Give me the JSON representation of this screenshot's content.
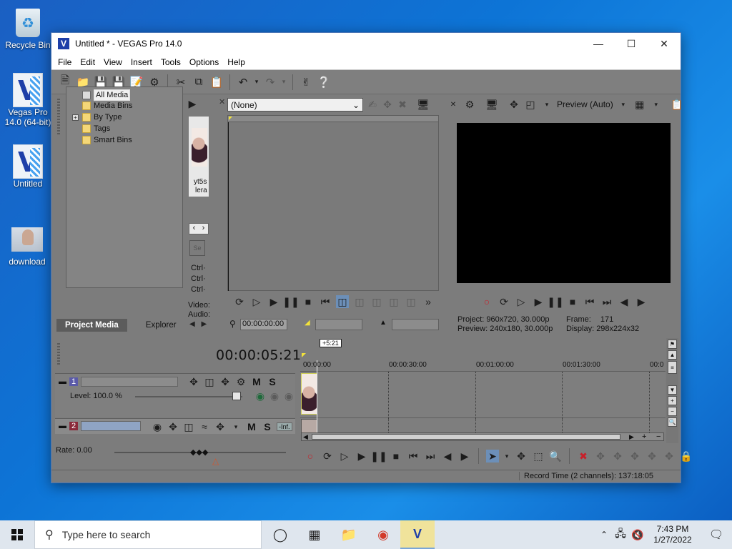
{
  "desktop": {
    "icons": [
      {
        "label": "Recycle Bin"
      },
      {
        "label": "Vegas Pro\n14.0 (64-bit)"
      },
      {
        "label": "Untitled"
      },
      {
        "label": "download"
      }
    ]
  },
  "window": {
    "title": "Untitled * - VEGAS Pro 14.0",
    "menu": [
      "File",
      "Edit",
      "View",
      "Insert",
      "Tools",
      "Options",
      "Help"
    ]
  },
  "project_media": {
    "tree": [
      "All Media",
      "Media Bins",
      "By Type",
      "Tags",
      "Smart Bins"
    ],
    "thumb_caption_1": "yt5s",
    "thumb_caption_2": "lera",
    "ctrl_lines": [
      "Ctrl·",
      "Ctrl·",
      "Ctrl·"
    ],
    "video_label": "Video:",
    "audio_label": "Audio:",
    "tab_active": "Project Media",
    "tab_other": "Explorer"
  },
  "trimmer": {
    "dropdown": "(None)",
    "timecode": "00:00:00:00"
  },
  "preview": {
    "mode": "Preview (Auto)",
    "project_label": "Project:",
    "project_value": "960x720, 30.000p",
    "preview_label": "Preview:",
    "preview_value": "240x180, 30.000p",
    "frame_label": "Frame:",
    "frame_value": "171",
    "display_label": "Display:",
    "display_value": "298x224x32"
  },
  "timeline": {
    "cursor_time": "00:00:05:21",
    "marker": "+5:21",
    "ruler": [
      "00:00:00",
      "00:00:30:00",
      "00:01:00:00",
      "00:01:30:00",
      "00:0"
    ],
    "track1_num": "1",
    "track1_letters": [
      "M",
      "S"
    ],
    "level": "Level: 100.0 %",
    "track2_num": "2",
    "track2_letters": [
      "M",
      "S"
    ],
    "track2_inf": "-Inf.",
    "rate": "Rate: 0.00",
    "record_time": "Record Time (2 channels): 137:18:05"
  },
  "taskbar": {
    "search_placeholder": "Type here to search",
    "time": "7:43 PM",
    "date": "1/27/2022"
  },
  "colors": {
    "desktop_blue": "#0d74d6",
    "vegas_panel_gray": "#7c7c7c",
    "record_red": "#c8202a"
  }
}
